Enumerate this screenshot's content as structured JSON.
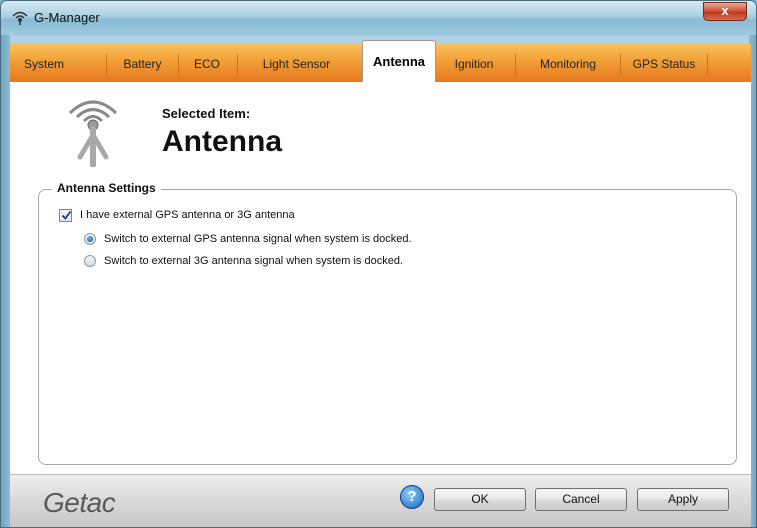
{
  "window": {
    "title": "G-Manager",
    "close_label": "x"
  },
  "tabs": [
    {
      "label": "System"
    },
    {
      "label": "Battery"
    },
    {
      "label": "ECO"
    },
    {
      "label": "Light Sensor"
    },
    {
      "label": "Antenna",
      "active": true
    },
    {
      "label": "Ignition"
    },
    {
      "label": "Monitoring"
    },
    {
      "label": "GPS Status"
    }
  ],
  "header": {
    "selected_label": "Selected Item:",
    "selected_value": "Antenna",
    "icon": "antenna-icon"
  },
  "settings": {
    "group_title": "Antenna Settings",
    "external_checkbox": {
      "label": "I have external GPS antenna or 3G antenna",
      "checked": true
    },
    "radios": [
      {
        "label": "Switch to external GPS antenna signal when system is docked.",
        "selected": true
      },
      {
        "label": "Switch to external 3G antenna signal when system is docked.",
        "selected": false
      }
    ]
  },
  "footer": {
    "logo": "Getac",
    "help_label": "?",
    "ok_label": "OK",
    "cancel_label": "Cancel",
    "apply_label": "Apply"
  },
  "colors": {
    "tab_gradient_top": "#f7c25c",
    "tab_gradient_bottom": "#e5781e",
    "radio_selected": "#0b56a8"
  }
}
